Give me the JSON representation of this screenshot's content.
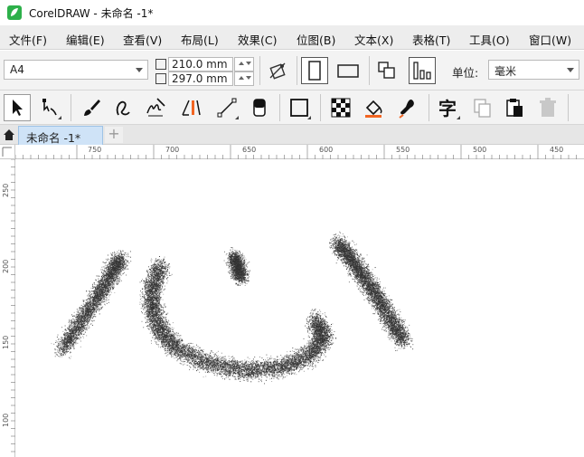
{
  "window": {
    "title": "CorelDRAW - 未命名 -1*"
  },
  "menu": [
    "文件(F)",
    "编辑(E)",
    "查看(V)",
    "布局(L)",
    "效果(C)",
    "位图(B)",
    "文本(X)",
    "表格(T)",
    "工具(O)",
    "窗口(W)"
  ],
  "property_bar": {
    "page_size": "A4",
    "width": "210.0 mm",
    "height": "297.0 mm",
    "units_label": "单位:",
    "units_value": "毫米"
  },
  "toolbox": [
    "pick-tool",
    "shape-tool",
    "artistic-media-tool",
    "bezier-tool",
    "freehand-tool",
    "dimension-tool",
    "connector-tool",
    "eraser-tool",
    "rectangle-tool",
    "transparency-tool",
    "fill-tool",
    "smart-fill-tool",
    "text-tool",
    "copy-tool",
    "paste-tool",
    "delete-tool"
  ],
  "tabs": {
    "active": "未命名 -1*",
    "add": "+"
  },
  "rulers": {
    "top": [
      "750",
      "700",
      "650",
      "600",
      "550",
      "500",
      "450"
    ],
    "left": [
      "250",
      "200",
      "150",
      "100"
    ]
  },
  "canvas": {
    "artwork": "心"
  },
  "colors": {
    "accent": "#2db04a",
    "tab_active": "#cfe3f7",
    "ink": "#333333",
    "highlight": "#f26522"
  }
}
